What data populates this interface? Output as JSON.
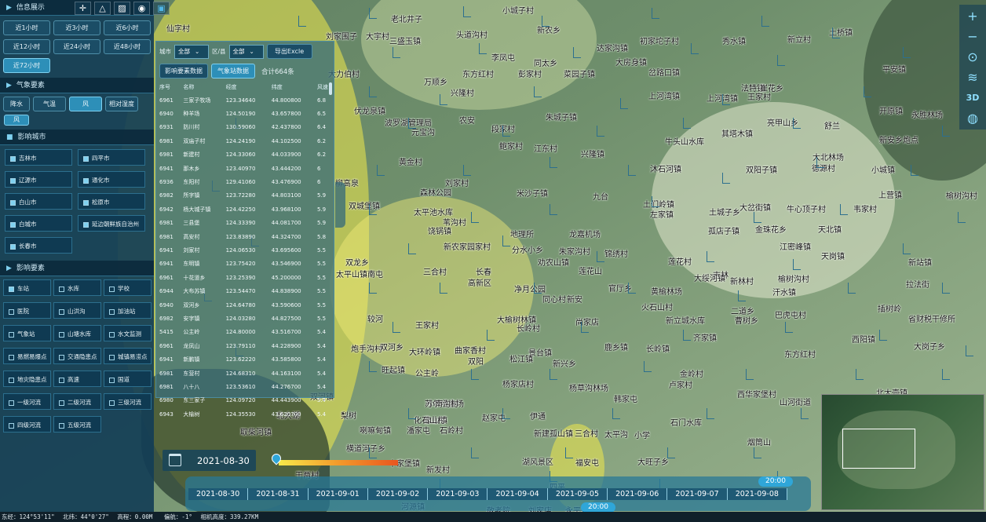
{
  "info_panel": {
    "title": "信息展示",
    "time_buttons": [
      "近1小时",
      "近3小时",
      "近6小时",
      "近12小时",
      "近24小时",
      "近48小时",
      "近72小时"
    ],
    "active_time": "近72小时"
  },
  "weather": {
    "title": "气象要素",
    "buttons": [
      "降水",
      "气温",
      "风",
      "相对湿度"
    ],
    "active": "风",
    "selected_tag": "风"
  },
  "cities": {
    "title": "影响城市",
    "items": [
      "吉林市",
      "四平市",
      "辽源市",
      "通化市",
      "白山市",
      "松原市",
      "白城市",
      "延边朝鲜族自治州",
      "长春市"
    ]
  },
  "factors": {
    "title": "影响要素",
    "items": [
      "车站",
      "水库",
      "学校",
      "医院",
      "山洪沟",
      "加油站",
      "气象站",
      "山塘水库",
      "水文监测",
      "易燃易爆点",
      "交通隐患点",
      "城镇易涝点",
      "地灾隐患点",
      "高速",
      "国道",
      "一级河流",
      "二级河流",
      "三级河流",
      "四级河流",
      "五级河流"
    ]
  },
  "table_panel": {
    "city_label": "城市",
    "city_value": "全部",
    "district_label": "区/县",
    "district_value": "全部",
    "export_button": "导出Excle",
    "tab_impact": "影响要素数据",
    "tab_station": "气象站数据",
    "total": "合计664条",
    "columns": [
      "序号",
      "名称",
      "经度",
      "纬度",
      "风速"
    ],
    "rows": [
      [
        "6961",
        "三家子牧场",
        "123.34640",
        "44.800800",
        "6.8"
      ],
      [
        "6940",
        "种羊场",
        "124.50190",
        "43.657800",
        "6.5"
      ],
      [
        "6931",
        "防川村",
        "130.59060",
        "42.437800",
        "6.4"
      ],
      [
        "6981",
        "双庙子村",
        "124.24190",
        "44.102500",
        "6.2"
      ],
      [
        "6981",
        "新建村",
        "124.33060",
        "44.033900",
        "6.2"
      ],
      [
        "6941",
        "那木乡",
        "123.40970",
        "43.444200",
        "6"
      ],
      [
        "6936",
        "东阳村",
        "129.41060",
        "43.476900",
        "6"
      ],
      [
        "6982",
        "所字镇",
        "123.72280",
        "44.803100",
        "5.9"
      ],
      [
        "6942",
        "杨大城子镇",
        "124.42250",
        "43.968100",
        "5.9"
      ],
      [
        "6981",
        "三县堡",
        "124.33390",
        "44.081700",
        "5.9"
      ],
      [
        "6981",
        "高安村",
        "123.83890",
        "44.324700",
        "5.8"
      ],
      [
        "6941",
        "刘家村",
        "124.06530",
        "43.695600",
        "5.5"
      ],
      [
        "6941",
        "东明镇",
        "123.75420",
        "43.546900",
        "5.5"
      ],
      [
        "6961",
        "十花道乡",
        "123.25390",
        "45.200000",
        "5.5"
      ],
      [
        "6944",
        "大布苏镇",
        "123.54470",
        "44.838900",
        "5.5"
      ],
      [
        "6940",
        "双河乡",
        "124.64780",
        "43.590600",
        "5.5"
      ],
      [
        "6982",
        "安字镇",
        "124.03280",
        "44.827500",
        "5.5"
      ],
      [
        "5415",
        "公主岭",
        "124.80000",
        "43.516700",
        "5.4"
      ],
      [
        "6961",
        "龙凤山",
        "123.79110",
        "44.228900",
        "5.4"
      ],
      [
        "6941",
        "新鹏镇",
        "123.62220",
        "43.585800",
        "5.4"
      ],
      [
        "6981",
        "东营村",
        "124.68310",
        "44.163100",
        "5.4"
      ],
      [
        "6981",
        "八十八",
        "123.53610",
        "44.276700",
        "5.4"
      ],
      [
        "6980",
        "东三家子",
        "124.09720",
        "44.443900",
        "5.4"
      ],
      [
        "6943",
        "大榆树",
        "124.35530",
        "43.620700",
        "5.4"
      ]
    ]
  },
  "map_places": [
    {
      "name": "仙字村",
      "kind": "place"
    },
    {
      "name": "老北井子",
      "kind": "place"
    },
    {
      "name": "小城子村",
      "kind": "place"
    },
    {
      "name": "刘家围子",
      "kind": "place"
    },
    {
      "name": "大宇村",
      "kind": "place"
    },
    {
      "name": "三盛玉镇",
      "kind": "place"
    },
    {
      "name": "头道沟村",
      "kind": "place"
    },
    {
      "name": "新农乡",
      "kind": "place"
    },
    {
      "name": "达家沟镇",
      "kind": "place"
    },
    {
      "name": "初家坨子村",
      "kind": "place"
    },
    {
      "name": "秀水镇",
      "kind": "place"
    },
    {
      "name": "新立村",
      "kind": "place"
    },
    {
      "name": "土桥镇",
      "kind": "place"
    },
    {
      "name": "大力伯村",
      "kind": "place"
    },
    {
      "name": "李凤屯",
      "kind": "place"
    },
    {
      "name": "同太乡",
      "kind": "place"
    },
    {
      "name": "大房身镇",
      "kind": "place"
    },
    {
      "name": "平安镇",
      "kind": "place"
    },
    {
      "name": "万顺乡",
      "kind": "place"
    },
    {
      "name": "东方红村",
      "kind": "place"
    },
    {
      "name": "彭家村",
      "kind": "place"
    },
    {
      "name": "菜园子镇",
      "kind": "place"
    },
    {
      "name": "岔路口镇",
      "kind": "place"
    },
    {
      "name": "兴隆村",
      "kind": "place"
    },
    {
      "name": "上河湾镇",
      "kind": "place"
    },
    {
      "name": "上河湾镇",
      "kind": "place"
    },
    {
      "name": "王家村",
      "kind": "place"
    },
    {
      "name": "法特镇",
      "kind": "place"
    },
    {
      "name": "崔花乡",
      "kind": "place"
    },
    {
      "name": "伏龙泉镇",
      "kind": "place"
    },
    {
      "name": "朱城子镇",
      "kind": "place"
    },
    {
      "name": "开原镇",
      "kind": "place"
    },
    {
      "name": "永胜林场",
      "kind": "place"
    },
    {
      "name": "波罗湖管理局",
      "kind": "place"
    },
    {
      "name": "农安",
      "kind": "place"
    },
    {
      "name": "段家村",
      "kind": "place"
    },
    {
      "name": "亮甲山乡",
      "kind": "place"
    },
    {
      "name": "舒兰",
      "kind": "place"
    },
    {
      "name": "元宝沟",
      "kind": "place"
    },
    {
      "name": "其塔木镇",
      "kind": "place"
    },
    {
      "name": "新安乡炮点",
      "kind": "place"
    },
    {
      "name": "鲍家村",
      "kind": "place"
    },
    {
      "name": "江东村",
      "kind": "place"
    },
    {
      "name": "牛头山水库",
      "kind": "place"
    },
    {
      "name": "兴隆镇",
      "kind": "place"
    },
    {
      "name": "大北林场",
      "kind": "place"
    },
    {
      "name": "黄金村",
      "kind": "place"
    },
    {
      "name": "沐石河镇",
      "kind": "place"
    },
    {
      "name": "双阳子镇",
      "kind": "place"
    },
    {
      "name": "德源村",
      "kind": "place"
    },
    {
      "name": "小城镇",
      "kind": "place"
    },
    {
      "name": "柳高泉",
      "kind": "place"
    },
    {
      "name": "刘家村",
      "kind": "place"
    },
    {
      "name": "森林公园",
      "kind": "place"
    },
    {
      "name": "米沙子镇",
      "kind": "place"
    },
    {
      "name": "九台",
      "kind": "place"
    },
    {
      "name": "土们岭镇",
      "kind": "place"
    },
    {
      "name": "上营镇",
      "kind": "place"
    },
    {
      "name": "榆树沟村",
      "kind": "place"
    },
    {
      "name": "双城堡镇",
      "kind": "place"
    },
    {
      "name": "太平池水库",
      "kind": "place"
    },
    {
      "name": "左家镇",
      "kind": "place"
    },
    {
      "name": "土城子乡",
      "kind": "place"
    },
    {
      "name": "大岔街镇",
      "kind": "place"
    },
    {
      "name": "苇沟村",
      "kind": "place"
    },
    {
      "name": "牛心顶子村",
      "kind": "place"
    },
    {
      "name": "韦家村",
      "kind": "place"
    },
    {
      "name": "饶锅镇",
      "kind": "place"
    },
    {
      "name": "地理所",
      "kind": "place"
    },
    {
      "name": "龙嘉机场",
      "kind": "place"
    },
    {
      "name": "孤店子镇",
      "kind": "place"
    },
    {
      "name": "金珠花乡",
      "kind": "place"
    },
    {
      "name": "天北镇",
      "kind": "place"
    },
    {
      "name": "锦绣村",
      "kind": "place"
    },
    {
      "name": "新农家园家村",
      "kind": "place"
    },
    {
      "name": "分水小乡",
      "kind": "place"
    },
    {
      "name": "朱家沟村",
      "kind": "place"
    },
    {
      "name": "江密峰镇",
      "kind": "place"
    },
    {
      "name": "天岗镇",
      "kind": "place"
    },
    {
      "name": "双龙乡",
      "kind": "place"
    },
    {
      "name": "劝农山镇",
      "kind": "place"
    },
    {
      "name": "莲花村",
      "kind": "place"
    },
    {
      "name": "新站镇",
      "kind": "place"
    },
    {
      "name": "三合村",
      "kind": "place"
    },
    {
      "name": "莲花山",
      "kind": "place"
    },
    {
      "name": "太平山镇南屯",
      "kind": "place"
    },
    {
      "name": "长春",
      "kind": "place"
    },
    {
      "name": "高新区",
      "kind": "place"
    },
    {
      "name": "吉林",
      "kind": "place"
    },
    {
      "name": "新林村",
      "kind": "place"
    },
    {
      "name": "榆树沟村",
      "kind": "place"
    },
    {
      "name": "拉法街",
      "kind": "place"
    },
    {
      "name": "官厅乡",
      "kind": "place"
    },
    {
      "name": "黄榆林场",
      "kind": "place"
    },
    {
      "name": "大绥河镇",
      "kind": "place"
    },
    {
      "name": "汗水镇",
      "kind": "place"
    },
    {
      "name": "净月公园",
      "kind": "place"
    },
    {
      "name": "同心村",
      "kind": "place"
    },
    {
      "name": "新安",
      "kind": "place"
    },
    {
      "name": "火石山村",
      "kind": "place"
    },
    {
      "name": "二道乡",
      "kind": "place"
    },
    {
      "name": "曹树乡",
      "kind": "place"
    },
    {
      "name": "插树岭",
      "kind": "place"
    },
    {
      "name": "巴虎屯村",
      "kind": "place"
    },
    {
      "name": "省财税干修所",
      "kind": "place"
    },
    {
      "name": "较河",
      "kind": "place"
    },
    {
      "name": "大榆树林镇",
      "kind": "place"
    },
    {
      "name": "新立城水库",
      "kind": "place"
    },
    {
      "name": "王家村",
      "kind": "place"
    },
    {
      "name": "长岭村",
      "kind": "place"
    },
    {
      "name": "尚家店",
      "kind": "place"
    },
    {
      "name": "齐家镇",
      "kind": "place"
    },
    {
      "name": "西阳镇",
      "kind": "place"
    },
    {
      "name": "炮手沟村",
      "kind": "place"
    },
    {
      "name": "双河乡",
      "kind": "place"
    },
    {
      "name": "大环岭镇",
      "kind": "place"
    },
    {
      "name": "曲家香村",
      "kind": "place"
    },
    {
      "name": "景台镇",
      "kind": "place"
    },
    {
      "name": "鹿乡镇",
      "kind": "place"
    },
    {
      "name": "长岭镇",
      "kind": "place"
    },
    {
      "name": "大岗子乡",
      "kind": "place"
    },
    {
      "name": "松江镇",
      "kind": "place"
    },
    {
      "name": "新兴乡",
      "kind": "place"
    },
    {
      "name": "双阳",
      "kind": "place"
    },
    {
      "name": "东方红村",
      "kind": "place"
    },
    {
      "name": "旺起镇",
      "kind": "place"
    },
    {
      "name": "公主岭",
      "kind": "place"
    },
    {
      "name": "金岭村",
      "kind": "place"
    },
    {
      "name": "苏尔哈渔场",
      "kind": "place"
    },
    {
      "name": "杨家店村",
      "kind": "place"
    },
    {
      "name": "杨草沟林场",
      "kind": "place"
    },
    {
      "name": "卢家村",
      "kind": "place"
    },
    {
      "name": "双河镇",
      "kind": "place"
    },
    {
      "name": "西华家堡村",
      "kind": "place"
    },
    {
      "name": "北大壶镇",
      "kind": "place"
    },
    {
      "name": "小南沟村",
      "kind": "place"
    },
    {
      "name": "靠山镇",
      "kind": "place"
    },
    {
      "name": "韩家屯",
      "kind": "place"
    },
    {
      "name": "山河街道",
      "kind": "place"
    },
    {
      "name": "北大湖",
      "kind": "place"
    },
    {
      "name": "梨树",
      "kind": "place"
    },
    {
      "name": "化石山村",
      "kind": "place"
    },
    {
      "name": "赵家屯",
      "kind": "place"
    },
    {
      "name": "伊通",
      "kind": "place"
    },
    {
      "name": "石门水库",
      "kind": "place"
    },
    {
      "name": "取柴河镇",
      "kind": "place"
    },
    {
      "name": "喇嘛甸镇",
      "kind": "place"
    },
    {
      "name": "潘家屯",
      "kind": "place"
    },
    {
      "name": "石岭村",
      "kind": "place"
    },
    {
      "name": "新建孤山镇",
      "kind": "place"
    },
    {
      "name": "三合村",
      "kind": "place"
    },
    {
      "name": "太平沟",
      "kind": "place"
    },
    {
      "name": "小学",
      "kind": "place"
    },
    {
      "name": "烟筒山",
      "kind": "place"
    },
    {
      "name": "横道河子乡",
      "kind": "place"
    },
    {
      "name": "十家堡镇",
      "kind": "place"
    },
    {
      "name": "湖风景区",
      "kind": "place"
    },
    {
      "name": "福安屯",
      "kind": "place"
    },
    {
      "name": "大旺子乡",
      "kind": "place"
    },
    {
      "name": "新发村",
      "kind": "place"
    },
    {
      "name": "干两村",
      "kind": "place"
    },
    {
      "name": "四平",
      "kind": "place"
    },
    {
      "name": "河源镇",
      "kind": "place"
    },
    {
      "name": "敬老院",
      "kind": "place"
    },
    {
      "name": "刘家店",
      "kind": "place"
    },
    {
      "name": "永平镇乡",
      "kind": "place"
    }
  ],
  "date_box": {
    "date": "2021-08-30"
  },
  "timeline": {
    "dates": [
      "2021-08-30",
      "2021-08-31",
      "2021-09-01",
      "2021-09-02",
      "2021-09-03",
      "2021-09-04",
      "2021-09-05",
      "2021-09-06",
      "2021-09-07",
      "2021-09-08"
    ],
    "top_time": "20:00",
    "bottom_time": "20:00"
  },
  "status": {
    "longitude": "东经：124°53'11\"",
    "latitude": "北纬：44°0'27\"",
    "elevation": "高程：0.00M",
    "tilt": "偏航：-1°",
    "camera": "相机高度：339.27KM"
  },
  "colors": {
    "panel": "#143e56",
    "accent": "#2d8fb8",
    "highlight": "#7fd0ef",
    "warning_yellow": "#f0e94a",
    "warning_orange": "#f39a2b"
  }
}
